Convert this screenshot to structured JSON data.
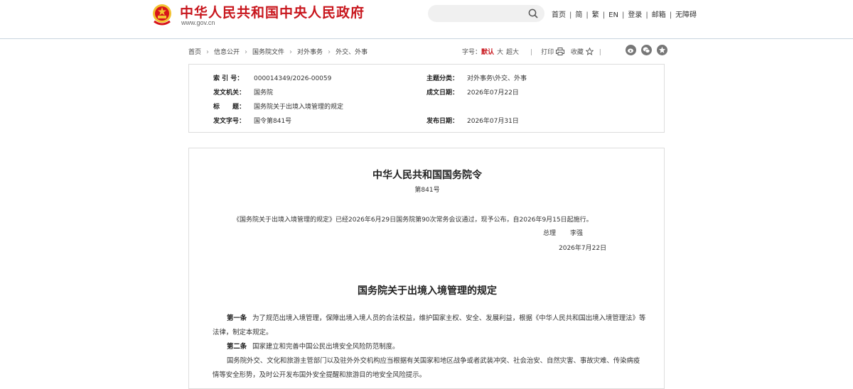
{
  "header": {
    "site_title": "中华人民共和国中央人民政府",
    "site_url": "www.gov.cn",
    "search_placeholder": "",
    "links": [
      "首页",
      "简",
      "繁",
      "EN",
      "登录",
      "邮箱",
      "无障碍"
    ]
  },
  "breadcrumb": [
    "首页",
    "信息公开",
    "国务院文件",
    "对外事务",
    "外交、外事"
  ],
  "tools": {
    "font_size_label": "字号：",
    "font_default": "默认",
    "font_large": "大",
    "font_xlarge": "超大",
    "print": "打印",
    "favorite": "收藏"
  },
  "meta": {
    "index_label": "索 引 号：",
    "index_value": "000014349/2026-00059",
    "topic_label": "主题分类：",
    "topic_value": "对外事务\\外交、外事",
    "issuer_label": "发文机关：",
    "issuer_value": "国务院",
    "created_label": "成文日期：",
    "created_value": "2026年07月22日",
    "title_label": "标　　题：",
    "title_value": "国务院关于出境入境管理的规定",
    "docno_label": "发文字号：",
    "docno_value": "国令第841号",
    "published_label": "发布日期：",
    "published_value": "2026年07月31日"
  },
  "document": {
    "title": "中华人民共和国国务院令",
    "number": "第841号",
    "decree_text": "《国务院关于出境入境管理的规定》已经2026年6月29日国务院第90次常务会议通过，现予公布，自2026年9月15日起施行。",
    "signer_title": "总理",
    "signer_name": "李强",
    "sign_date": "2026年7月22日",
    "regulation_title": "国务院关于出境入境管理的规定",
    "articles": [
      {
        "label": "第一条",
        "text": "为了规范出境入境管理，保障出境入境人员的合法权益，维护国家主权、安全、发展利益，根据《中华人民共和国出境入境管理法》等法律，制定本规定。"
      },
      {
        "label": "第二条",
        "text": "国家建立和完善中国公民出境安全风险防范制度。"
      }
    ],
    "paragraph_3": "国务院外交、文化和旅游主管部门以及驻外外交机构应当根据有关国家和地区战争或者武装冲突、社会治安、自然灾害、事故灾难、传染病疫情等安全形势，及时公开发布国外安全提醒和旅游目的地安全风险提示。"
  },
  "colors": {
    "brand_red": "#c8161d",
    "header_border": "#c9d4df",
    "box_border": "#dddddd"
  }
}
